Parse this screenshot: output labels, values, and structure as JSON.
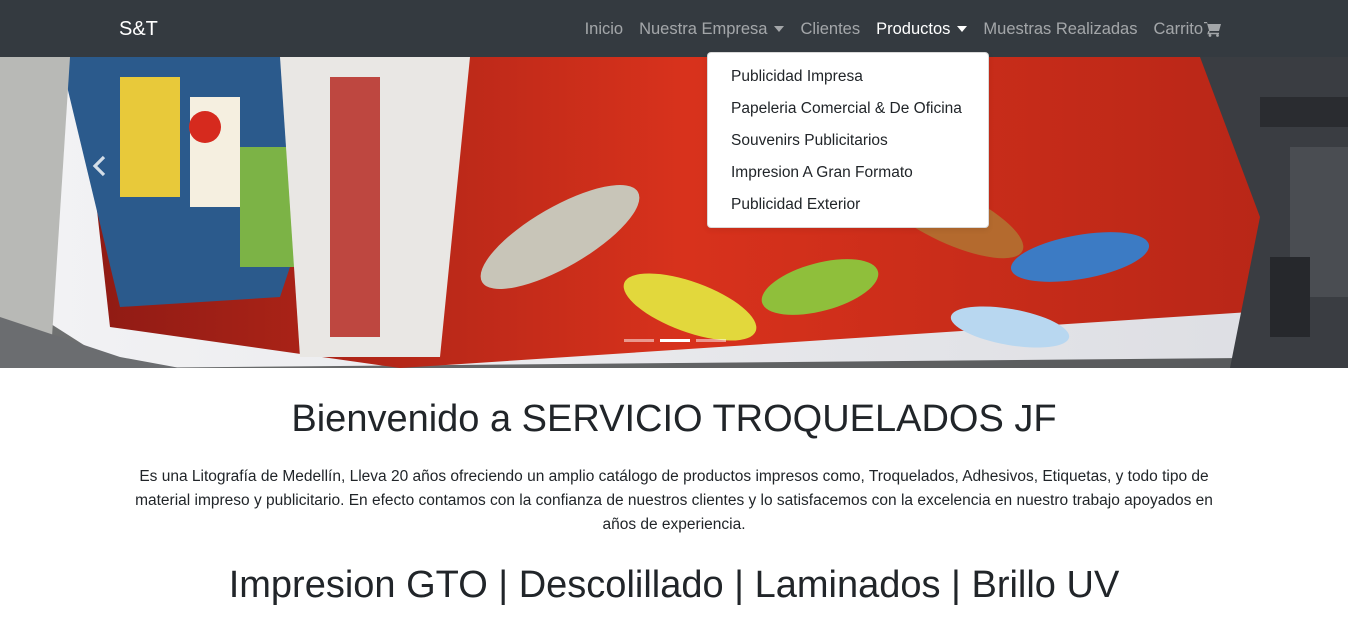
{
  "navbar": {
    "brand": "S&T",
    "items": [
      {
        "label": "Inicio"
      },
      {
        "label": "Nuestra Empresa"
      },
      {
        "label": "Clientes"
      },
      {
        "label": "Productos"
      },
      {
        "label": "Muestras Realizadas"
      },
      {
        "label": "Carrito"
      }
    ]
  },
  "dropdown": {
    "items": [
      {
        "label": "Publicidad Impresa"
      },
      {
        "label": "Papeleria Comercial & De Oficina"
      },
      {
        "label": "Souvenirs Publicitarios"
      },
      {
        "label": "Impresion A Gran Formato"
      },
      {
        "label": "Publicidad Exterior"
      }
    ]
  },
  "carousel": {
    "slide_count": 3,
    "active_index": 1
  },
  "main": {
    "welcome_title": "Bienvenido a SERVICIO TROQUELADOS JF",
    "intro": "Es una Litografía de Medellín, Lleva 20 años ofreciendo un amplio catálogo de productos impresos como, Troquelados, Adhesivos, Etiquetas, y todo tipo de material impreso y publicitario. En efecto contamos con la confianza de nuestros clientes y lo satisfacemos con la excelencia en nuestro trabajo apoyados en años de experiencia.",
    "services_title": "Impresion GTO | Descolillado | Laminados | Brillo UV"
  },
  "colors": {
    "navbar_bg": "#343a40",
    "text": "#212529"
  }
}
